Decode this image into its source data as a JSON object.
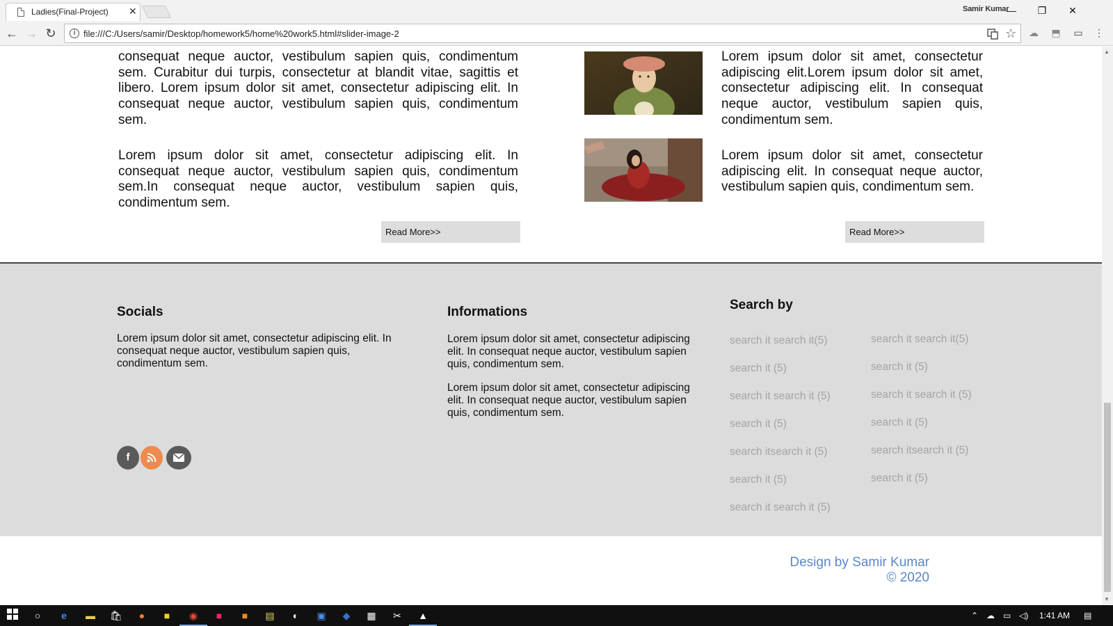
{
  "browser": {
    "tab_title": "Ladies(Final-Project)",
    "tab_close": "✕",
    "profile_name": "Samir Kumar",
    "url": "file:///C:/Users/samir/Desktop/homework5/home%20work5.html#slider-image-2",
    "window_controls": {
      "minimize": "—",
      "restore": "❐",
      "close": "✕"
    },
    "nav": {
      "back": "←",
      "forward": "→",
      "reload": "↻"
    }
  },
  "articles": {
    "left_para_1": "consequat neque auctor, vestibulum sapien quis, condimentum sem. Curabitur dui turpis, consectetur at blandit vitae, sagittis et libero. Lorem ipsum dolor sit amet, consectetur adipiscing elit. In consequat neque auctor, vestibulum sapien quis, condimentum sem.",
    "left_para_2": "Lorem ipsum dolor sit amet, consectetur adipiscing elit. In consequat neque auctor, vestibulum sapien quis, condimentum sem.In consequat neque auctor, vestibulum sapien quis, condimentum sem.",
    "right_para_1": "Lorem ipsum dolor sit amet, consectetur adipiscing elit.Lorem ipsum dolor sit amet, consectetur adipiscing elit. In consequat neque auctor, vestibulum sapien quis, condimentum sem.",
    "right_para_2": "Lorem ipsum dolor sit amet, consectetur adipiscing elit. In consequat neque auctor, vestibulum sapien quis, condimentum sem.",
    "read_more": "Read More>>"
  },
  "footer": {
    "socials": {
      "heading": "Socials",
      "text": "Lorem ipsum dolor sit amet, consectetur adipiscing elit. In consequat neque auctor, vestibulum sapien quis, condimentum sem.",
      "icons": [
        "facebook-icon",
        "rss-icon",
        "email-icon"
      ],
      "colors": {
        "facebook": "#5a5a5a",
        "rss": "#ee8a4f",
        "email": "#5a5a5a"
      }
    },
    "informations": {
      "heading": "Informations",
      "text_1": "Lorem ipsum dolor sit amet, consectetur adipiscing elit. In consequat neque auctor, vestibulum sapien quis, condimentum sem.",
      "text_2": "Lorem ipsum dolor sit amet, consectetur adipiscing elit. In consequat neque auctor, vestibulum sapien quis, condimentum sem."
    },
    "search_by": {
      "heading": "Search by",
      "col1": [
        "search it search it(5)",
        "search it (5)",
        "search it search it (5)",
        "search it (5)",
        "search itsearch it (5)",
        "search it (5)",
        "search it search it (5)"
      ],
      "col2": [
        "search it search it(5)",
        "search it (5)",
        "search it search it (5)",
        "search it (5)",
        "search itsearch it (5)",
        "search it (5)"
      ]
    }
  },
  "credit": {
    "line1": "Design by Samir Kumar",
    "line2": "© 2020",
    "color": "#5b86c9"
  },
  "taskbar": {
    "time": "1:41 AM"
  }
}
